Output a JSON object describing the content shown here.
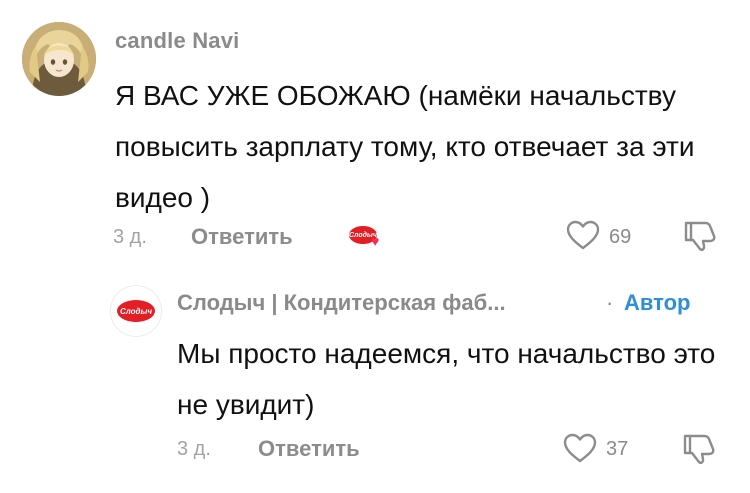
{
  "comment": {
    "author": "candle Navi",
    "avatar": "anime-character-avatar",
    "text": "Я ВАС УЖЕ ОБОЖАЮ (намёки начальству повысить зарплату тому, кто отвечает за эти видео )",
    "date": "3 д.",
    "reply_label": "Ответить",
    "likes": "69",
    "icons": {
      "like": "heart-outline-icon",
      "dislike": "thumb-down-icon",
      "creator_liked": "creator-heart-badge"
    },
    "badge_text": "Слодыч"
  },
  "reply": {
    "author": "Слодыч | Кондитерская фаб...",
    "separator": "·",
    "author_tag": "Автор",
    "avatar_text": "Слодыч",
    "text": "Мы просто надеемся, что начальство это не увидит)",
    "date": "3 д.",
    "reply_label": "Ответить",
    "likes": "37"
  },
  "colors": {
    "brand_red": "#e31e24",
    "author_blue": "#2d8fd5",
    "heart_pink": "#f22e52",
    "meta_gray": "#8c8c8c"
  }
}
